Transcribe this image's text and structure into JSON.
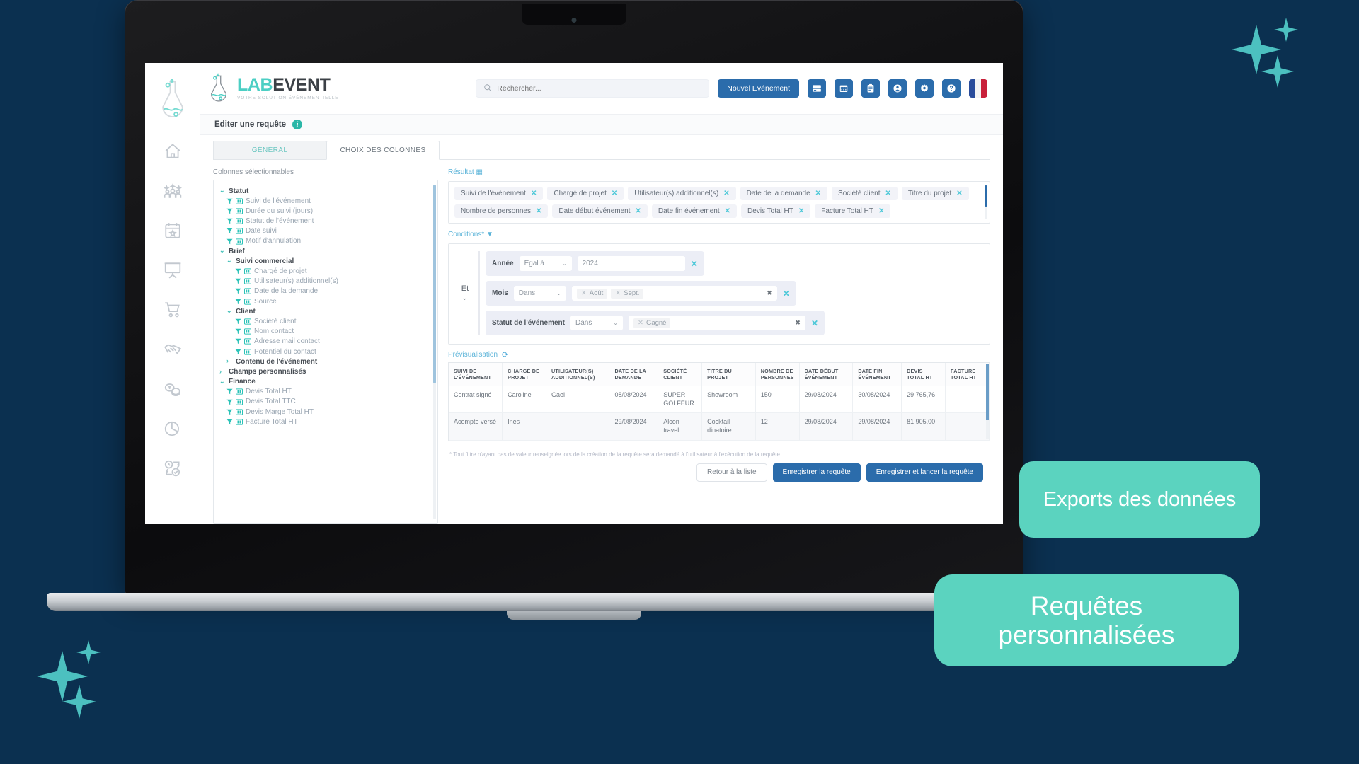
{
  "brand": {
    "lab": "LAB",
    "event": "EVENT",
    "tagline": "VOTRE SOLUTION ÉVÉNEMENTIELLE"
  },
  "topbar": {
    "search_placeholder": "Rechercher...",
    "new_event_label": "Nouvel Evénement",
    "icons": [
      "server-icon",
      "calendar-icon",
      "clipboard-icon",
      "user-icon",
      "gear-icon",
      "help-icon",
      "french-flag-icon"
    ]
  },
  "sidebar": {
    "items": [
      {
        "name": "home-icon"
      },
      {
        "name": "team-icon"
      },
      {
        "name": "calendar-star-icon"
      },
      {
        "name": "presentation-icon"
      },
      {
        "name": "cart-icon"
      },
      {
        "name": "handshake-icon"
      },
      {
        "name": "coins-icon"
      },
      {
        "name": "pie-chart-icon"
      },
      {
        "name": "task-clock-icon"
      }
    ]
  },
  "pagehead": {
    "title": "Editer une requête",
    "info_badge": "i"
  },
  "tabs": [
    {
      "label": "GÉNÉRAL",
      "active": false
    },
    {
      "label": "CHOIX DES COLONNES",
      "active": true
    }
  ],
  "columns_panel": {
    "label": "Colonnes sélectionnables",
    "tree": [
      {
        "level": 0,
        "type": "group",
        "expanded": true,
        "label": "Statut"
      },
      {
        "level": 1,
        "type": "leaf",
        "label": "Suivi de l'événement"
      },
      {
        "level": 1,
        "type": "leaf",
        "label": "Durée du suivi (jours)"
      },
      {
        "level": 1,
        "type": "leaf",
        "label": "Statut de l'événement"
      },
      {
        "level": 1,
        "type": "leaf",
        "label": "Date suivi"
      },
      {
        "level": 1,
        "type": "leaf",
        "label": "Motif d'annulation"
      },
      {
        "level": 0,
        "type": "group",
        "expanded": true,
        "label": "Brief"
      },
      {
        "level": 1,
        "type": "group",
        "expanded": true,
        "label": "Suivi commercial"
      },
      {
        "level": 2,
        "type": "leaf",
        "label": "Chargé de projet"
      },
      {
        "level": 2,
        "type": "leaf",
        "label": "Utilisateur(s) additionnel(s)"
      },
      {
        "level": 2,
        "type": "leaf",
        "label": "Date de la demande"
      },
      {
        "level": 2,
        "type": "leaf",
        "label": "Source"
      },
      {
        "level": 1,
        "type": "group",
        "expanded": true,
        "label": "Client"
      },
      {
        "level": 2,
        "type": "leaf",
        "label": "Société client"
      },
      {
        "level": 2,
        "type": "leaf",
        "label": "Nom contact"
      },
      {
        "level": 2,
        "type": "leaf",
        "label": "Adresse mail contact"
      },
      {
        "level": 2,
        "type": "leaf",
        "label": "Potentiel du contact"
      },
      {
        "level": 1,
        "type": "group",
        "expanded": false,
        "label": "Contenu de l'événement"
      },
      {
        "level": 0,
        "type": "group",
        "expanded": false,
        "label": "Champs personnalisés"
      },
      {
        "level": 0,
        "type": "group",
        "expanded": true,
        "label": "Finance"
      },
      {
        "level": 1,
        "type": "leaf",
        "label": "Devis Total HT"
      },
      {
        "level": 1,
        "type": "leaf",
        "label": "Devis Total TTC"
      },
      {
        "level": 1,
        "type": "leaf",
        "label": "Devis Marge Total HT"
      },
      {
        "level": 1,
        "type": "leaf",
        "label": "Facture Total HT"
      }
    ]
  },
  "result": {
    "label": "Résultat",
    "tags": [
      "Suivi de l'événement",
      "Chargé de projet",
      "Utilisateur(s) additionnel(s)",
      "Date de la demande",
      "Société client",
      "Titre du projet",
      "Nombre de personnes",
      "Date début événement",
      "Date fin événement",
      "Devis Total HT",
      "Facture Total HT"
    ],
    "tag_close": "✕"
  },
  "conditions": {
    "label": "Conditions*",
    "operator": "Et",
    "rows": [
      {
        "field": "Année",
        "operator": "Egal à",
        "value_type": "text",
        "value": "2024",
        "chips": []
      },
      {
        "field": "Mois",
        "operator": "Dans",
        "value_type": "chips",
        "value": "",
        "chips": [
          "Août",
          "Sept."
        ]
      },
      {
        "field": "Statut de l'événement",
        "operator": "Dans",
        "value_type": "chips",
        "value": "",
        "chips": [
          "Gagné"
        ]
      }
    ]
  },
  "preview": {
    "label": "Prévisualisation",
    "columns": [
      "SUIVI DE L'ÉVÉNEMENT",
      "CHARGÉ DE PROJET",
      "UTILISATEUR(S) ADDITIONNEL(S)",
      "DATE DE LA DEMANDE",
      "SOCIÉTÉ CLIENT",
      "TITRE DU PROJET",
      "NOMBRE DE PERSONNES",
      "DATE DÉBUT ÉVÉNEMENT",
      "DATE FIN ÉVÉNEMENT",
      "DEVIS TOTAL HT",
      "FACTURE TOTAL HT"
    ],
    "rows": [
      [
        "Contrat signé",
        "Caroline",
        "Gael",
        "08/08/2024",
        "SUPER GOLFEUR",
        "Showroom",
        "150",
        "29/08/2024",
        "30/08/2024",
        "29 765,76",
        ""
      ],
      [
        "Acompte versé",
        "Ines",
        "",
        "29/08/2024",
        "Alcon travel",
        "Cocktail dinatoire",
        "12",
        "29/08/2024",
        "29/08/2024",
        "81 905,00",
        ""
      ]
    ]
  },
  "footer": {
    "note": "* Tout filtre n'ayant pas de valeur renseignée lors de la création de la requête sera demandé à l'utilisateur à l'exécution de la requête",
    "back_label": "Retour à la liste",
    "save_label": "Enregistrer la requête",
    "save_run_label": "Enregistrer et lancer la requête"
  },
  "callouts": [
    {
      "text": "Exports des données"
    },
    {
      "text": "Requêtes personnalisées"
    }
  ],
  "colors": {
    "background": "#0b3050",
    "accent_teal": "#4ccfc4",
    "callout_teal": "#5bd3bf",
    "primary_blue": "#2b6cab"
  }
}
